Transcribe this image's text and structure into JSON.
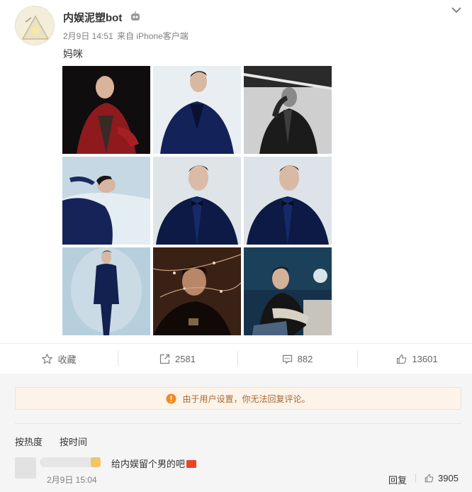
{
  "post": {
    "author": "内娱泥塑bot",
    "date": "2月9日 14:51",
    "source": "来自 iPhone客户端",
    "text": "妈咪",
    "photos": [
      {
        "icon": "photo-red-suit"
      },
      {
        "icon": "photo-navy-suit-light"
      },
      {
        "icon": "photo-black-white"
      },
      {
        "icon": "photo-reclining"
      },
      {
        "icon": "photo-bowtie-1"
      },
      {
        "icon": "photo-bowtie-2"
      },
      {
        "icon": "photo-full-body"
      },
      {
        "icon": "photo-branches"
      },
      {
        "icon": "photo-studio-sitting"
      }
    ]
  },
  "actions": {
    "favorite_label": "收藏",
    "repost_count": "2581",
    "comment_count": "882",
    "like_count": "13601"
  },
  "notice": {
    "text": "由于用户设置，你无法回复评论。"
  },
  "sort": {
    "hot": "按热度",
    "time": "按时间"
  },
  "comment": {
    "text": "给内娱留个男的吧",
    "time": "2月9日 15:04",
    "reply_label": "回复",
    "like_count": "3905"
  },
  "colors": {
    "notice_bg": "#fdf3e9",
    "notice_text": "#a26b35",
    "warning_icon": "#f08a24"
  }
}
